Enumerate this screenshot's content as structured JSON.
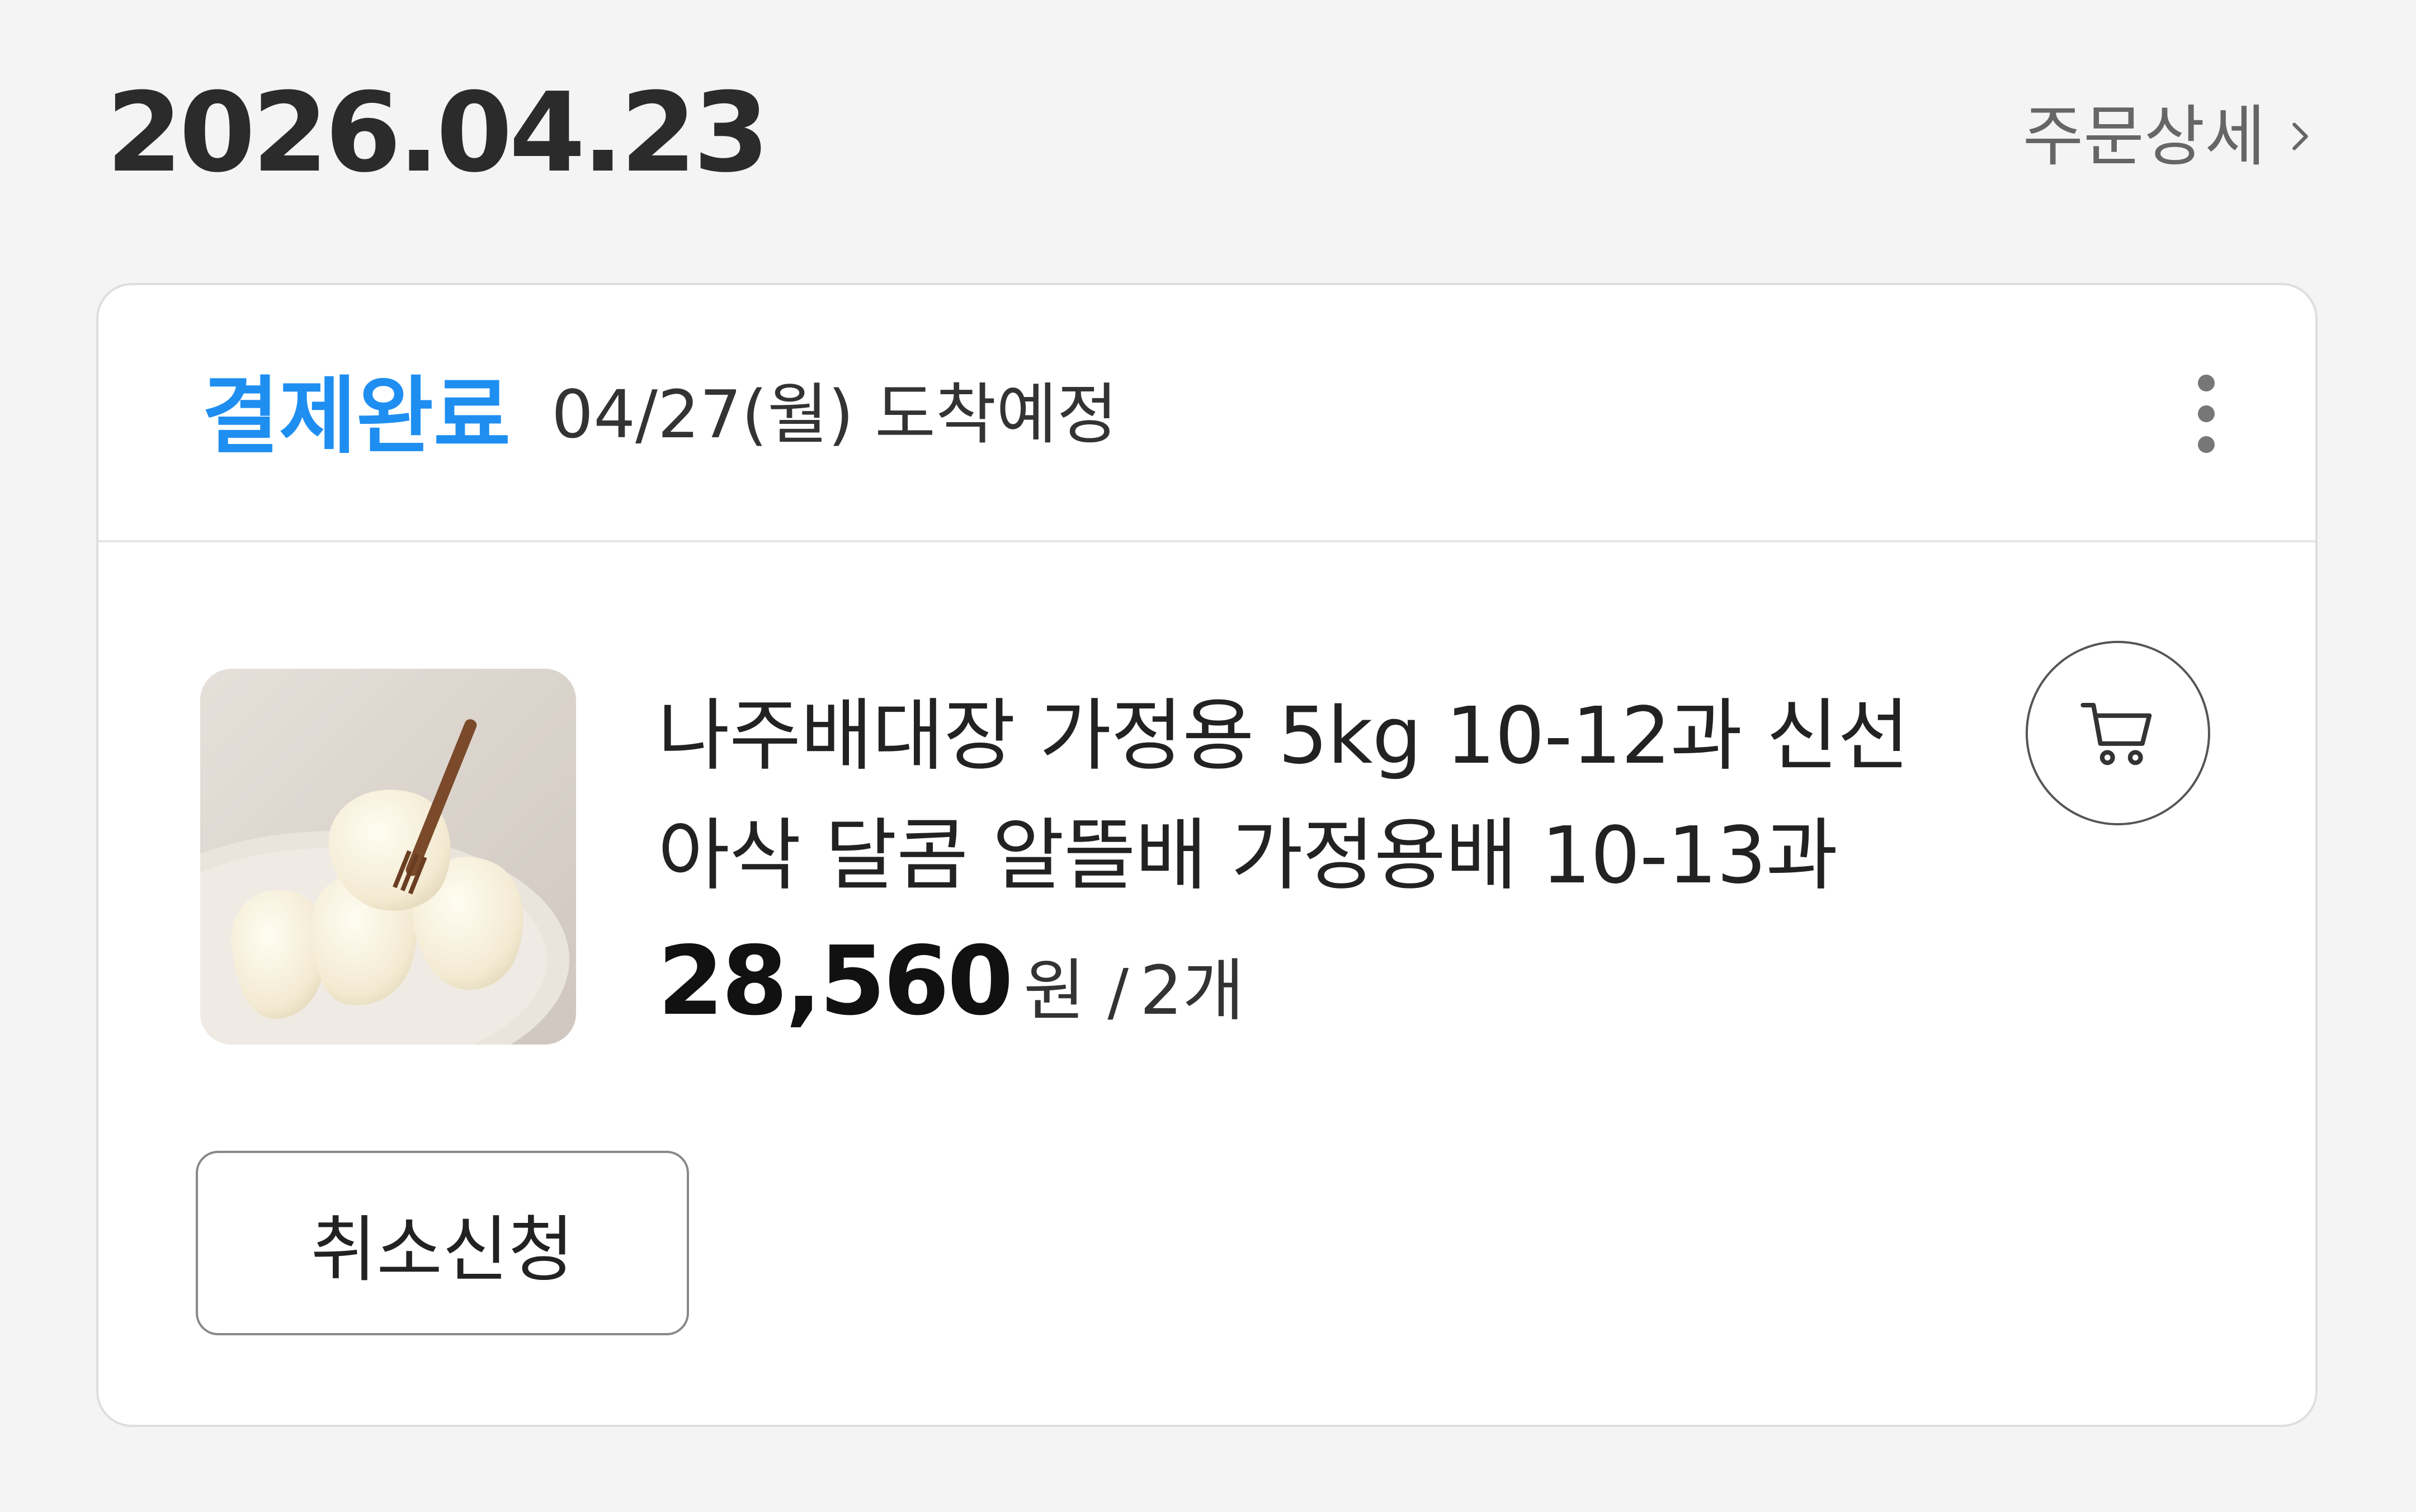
{
  "order": {
    "date": "2026.04.23",
    "detail_link_label": "주문상세"
  },
  "card": {
    "status": "결제완료",
    "eta": "04/27(월) 도착예정"
  },
  "product": {
    "name_line1": "나주배대장 가정용 5kg 10-12과 신선",
    "name_line2": "아삭 달콤 알뜰배 가정용배 10-13과",
    "price": "28,560",
    "currency": "원",
    "qty_separator": "/",
    "quantity": "2개",
    "image_icon": "pear-slices-image"
  },
  "actions": {
    "cancel_label": "취소신청",
    "cart_icon": "shopping-cart-icon",
    "more_icon": "more-vertical-icon"
  },
  "colors": {
    "status_blue": "#1f8ef1",
    "background": "#f4f4f4",
    "card_bg": "#ffffff"
  }
}
